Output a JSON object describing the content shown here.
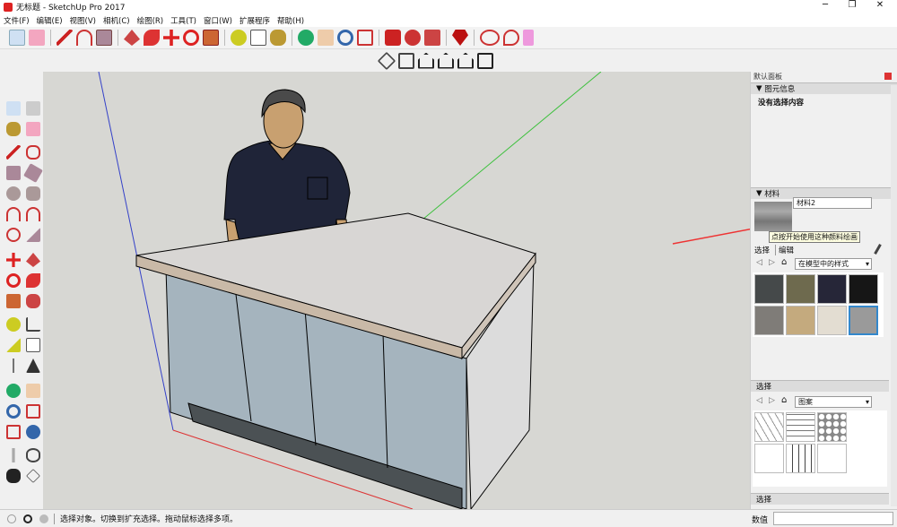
{
  "window": {
    "title": "无标题 - SketchUp Pro 2017",
    "min": "─",
    "max": "❐",
    "close": "✕"
  },
  "menu": [
    "文件(F)",
    "编辑(E)",
    "视图(V)",
    "相机(C)",
    "绘图(R)",
    "工具(T)",
    "窗口(W)",
    "扩展程序",
    "帮助(H)"
  ],
  "toolbar_icons": [
    "select",
    "eraser",
    "pencil",
    "arc",
    "rectangle",
    "push-pull",
    "follow-me",
    "move",
    "rotate",
    "scale",
    "tape",
    "text",
    "paint",
    "orbit",
    "pan",
    "zoom",
    "zoom-extents",
    "warehouse",
    "extension-warehouse",
    "send-layout",
    "ruby",
    "cloud",
    "location",
    "report"
  ],
  "view_icons": [
    "iso",
    "top",
    "front",
    "right",
    "back",
    "left"
  ],
  "panel": {
    "title": "默认面板",
    "entity_info": {
      "header": "图元信息",
      "text": "没有选择内容"
    },
    "materials": {
      "header": "材料",
      "name": "材料2",
      "tooltip": "点按开始使用这种颜料绘画",
      "tabs": [
        "选择",
        "编辑"
      ],
      "collection": "在模型中的样式",
      "swatches": [
        "#45494a",
        "#6e6a4e",
        "#262638",
        "#161616",
        "#7f7c78",
        "#c4aa7e",
        "#e3ddd2",
        "#9a9a9a"
      ],
      "second": {
        "header": "选择",
        "collection": "图案"
      },
      "footer": "选择"
    }
  },
  "status": {
    "text": "选择对象。切换到扩充选择。拖动鼠标选择多项。",
    "measure_label": "数值",
    "measure_value": ""
  }
}
